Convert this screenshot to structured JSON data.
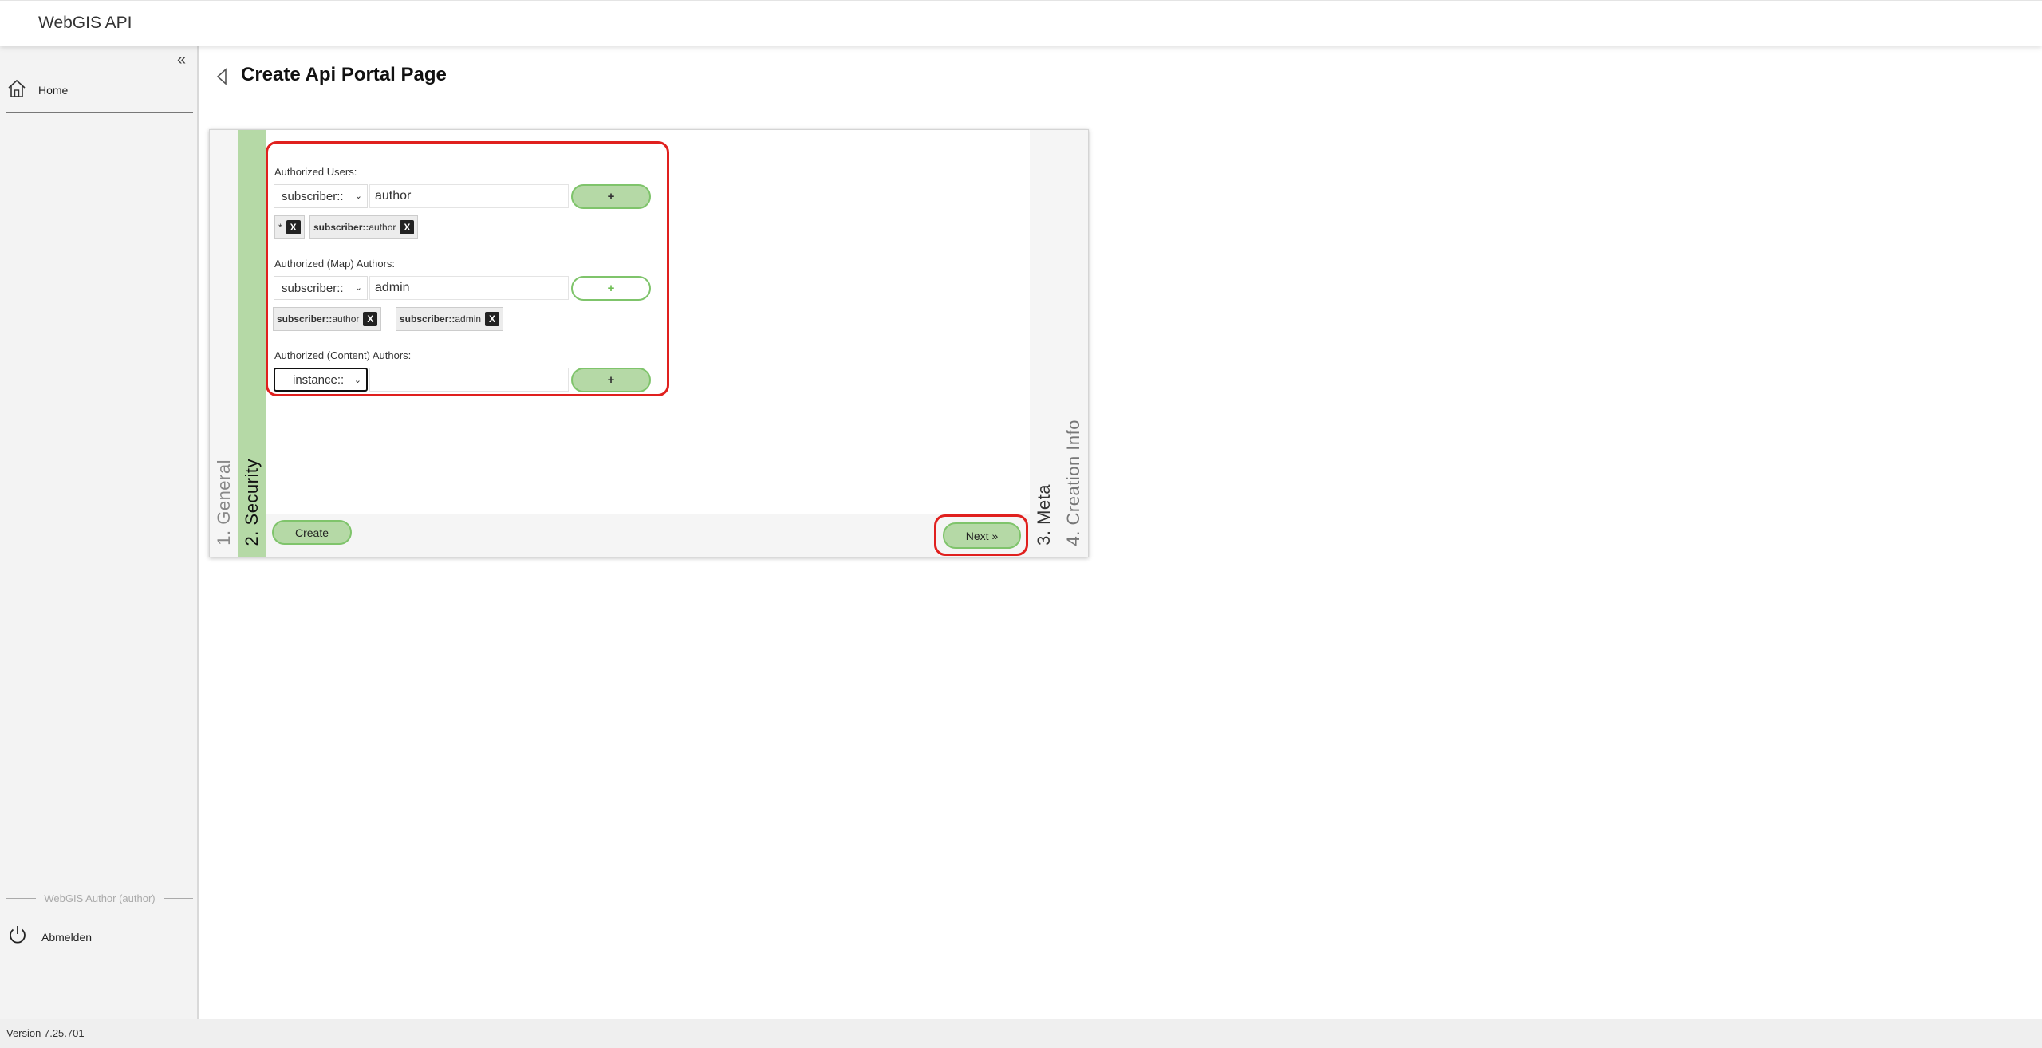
{
  "header": {
    "title": "WebGIS API"
  },
  "sidebar": {
    "collapse_label": "«",
    "home_label": "Home",
    "user_label": "WebGIS Author (author)",
    "logout_label": "Abmelden"
  },
  "footer": {
    "version": "Version 7.25.701"
  },
  "page": {
    "title": "Create Api Portal Page"
  },
  "wizard": {
    "tabs": [
      {
        "label": "1.  General"
      },
      {
        "label": "2.  Security"
      },
      {
        "label": "3.  Meta"
      },
      {
        "label": "4.  Creation Info"
      }
    ],
    "authorized_users": {
      "label": "Authorized Users:",
      "select_value": "subscriber::",
      "input_value": "author",
      "add_label": "+",
      "chips": [
        {
          "prefix": "",
          "name": "*",
          "remove": "X"
        },
        {
          "prefix": "subscriber::",
          "name": "author",
          "remove": "X"
        }
      ]
    },
    "map_authors": {
      "label": "Authorized (Map) Authors:",
      "select_value": "subscriber::",
      "input_value": "admin",
      "add_label": "+",
      "chips": [
        {
          "prefix": "subscriber::",
          "name": "author",
          "remove": "X"
        },
        {
          "prefix": "subscriber::",
          "name": "admin",
          "remove": "X"
        }
      ]
    },
    "content_authors": {
      "label": "Authorized (Content) Authors:",
      "select_value": "instance::",
      "input_value": "",
      "add_label": "+"
    },
    "create_label": "Create",
    "next_label": "Next »"
  }
}
